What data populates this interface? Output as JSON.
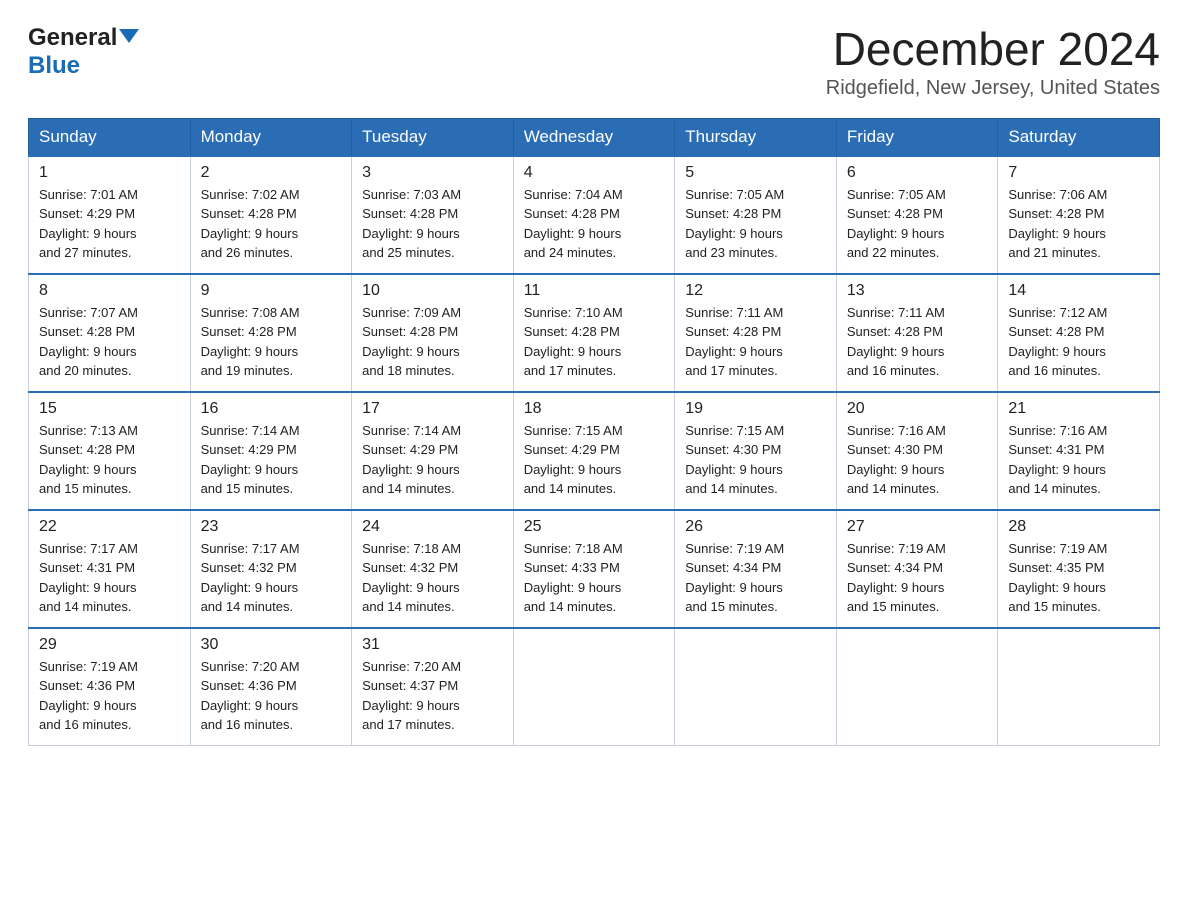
{
  "logo": {
    "general": "General",
    "blue": "Blue"
  },
  "title": "December 2024",
  "subtitle": "Ridgefield, New Jersey, United States",
  "days_of_week": [
    "Sunday",
    "Monday",
    "Tuesday",
    "Wednesday",
    "Thursday",
    "Friday",
    "Saturday"
  ],
  "weeks": [
    [
      {
        "day": "1",
        "sunrise": "7:01 AM",
        "sunset": "4:29 PM",
        "daylight": "9 hours and 27 minutes."
      },
      {
        "day": "2",
        "sunrise": "7:02 AM",
        "sunset": "4:28 PM",
        "daylight": "9 hours and 26 minutes."
      },
      {
        "day": "3",
        "sunrise": "7:03 AM",
        "sunset": "4:28 PM",
        "daylight": "9 hours and 25 minutes."
      },
      {
        "day": "4",
        "sunrise": "7:04 AM",
        "sunset": "4:28 PM",
        "daylight": "9 hours and 24 minutes."
      },
      {
        "day": "5",
        "sunrise": "7:05 AM",
        "sunset": "4:28 PM",
        "daylight": "9 hours and 23 minutes."
      },
      {
        "day": "6",
        "sunrise": "7:05 AM",
        "sunset": "4:28 PM",
        "daylight": "9 hours and 22 minutes."
      },
      {
        "day": "7",
        "sunrise": "7:06 AM",
        "sunset": "4:28 PM",
        "daylight": "9 hours and 21 minutes."
      }
    ],
    [
      {
        "day": "8",
        "sunrise": "7:07 AM",
        "sunset": "4:28 PM",
        "daylight": "9 hours and 20 minutes."
      },
      {
        "day": "9",
        "sunrise": "7:08 AM",
        "sunset": "4:28 PM",
        "daylight": "9 hours and 19 minutes."
      },
      {
        "day": "10",
        "sunrise": "7:09 AM",
        "sunset": "4:28 PM",
        "daylight": "9 hours and 18 minutes."
      },
      {
        "day": "11",
        "sunrise": "7:10 AM",
        "sunset": "4:28 PM",
        "daylight": "9 hours and 17 minutes."
      },
      {
        "day": "12",
        "sunrise": "7:11 AM",
        "sunset": "4:28 PM",
        "daylight": "9 hours and 17 minutes."
      },
      {
        "day": "13",
        "sunrise": "7:11 AM",
        "sunset": "4:28 PM",
        "daylight": "9 hours and 16 minutes."
      },
      {
        "day": "14",
        "sunrise": "7:12 AM",
        "sunset": "4:28 PM",
        "daylight": "9 hours and 16 minutes."
      }
    ],
    [
      {
        "day": "15",
        "sunrise": "7:13 AM",
        "sunset": "4:28 PM",
        "daylight": "9 hours and 15 minutes."
      },
      {
        "day": "16",
        "sunrise": "7:14 AM",
        "sunset": "4:29 PM",
        "daylight": "9 hours and 15 minutes."
      },
      {
        "day": "17",
        "sunrise": "7:14 AM",
        "sunset": "4:29 PM",
        "daylight": "9 hours and 14 minutes."
      },
      {
        "day": "18",
        "sunrise": "7:15 AM",
        "sunset": "4:29 PM",
        "daylight": "9 hours and 14 minutes."
      },
      {
        "day": "19",
        "sunrise": "7:15 AM",
        "sunset": "4:30 PM",
        "daylight": "9 hours and 14 minutes."
      },
      {
        "day": "20",
        "sunrise": "7:16 AM",
        "sunset": "4:30 PM",
        "daylight": "9 hours and 14 minutes."
      },
      {
        "day": "21",
        "sunrise": "7:16 AM",
        "sunset": "4:31 PM",
        "daylight": "9 hours and 14 minutes."
      }
    ],
    [
      {
        "day": "22",
        "sunrise": "7:17 AM",
        "sunset": "4:31 PM",
        "daylight": "9 hours and 14 minutes."
      },
      {
        "day": "23",
        "sunrise": "7:17 AM",
        "sunset": "4:32 PM",
        "daylight": "9 hours and 14 minutes."
      },
      {
        "day": "24",
        "sunrise": "7:18 AM",
        "sunset": "4:32 PM",
        "daylight": "9 hours and 14 minutes."
      },
      {
        "day": "25",
        "sunrise": "7:18 AM",
        "sunset": "4:33 PM",
        "daylight": "9 hours and 14 minutes."
      },
      {
        "day": "26",
        "sunrise": "7:19 AM",
        "sunset": "4:34 PM",
        "daylight": "9 hours and 15 minutes."
      },
      {
        "day": "27",
        "sunrise": "7:19 AM",
        "sunset": "4:34 PM",
        "daylight": "9 hours and 15 minutes."
      },
      {
        "day": "28",
        "sunrise": "7:19 AM",
        "sunset": "4:35 PM",
        "daylight": "9 hours and 15 minutes."
      }
    ],
    [
      {
        "day": "29",
        "sunrise": "7:19 AM",
        "sunset": "4:36 PM",
        "daylight": "9 hours and 16 minutes."
      },
      {
        "day": "30",
        "sunrise": "7:20 AM",
        "sunset": "4:36 PM",
        "daylight": "9 hours and 16 minutes."
      },
      {
        "day": "31",
        "sunrise": "7:20 AM",
        "sunset": "4:37 PM",
        "daylight": "9 hours and 17 minutes."
      },
      null,
      null,
      null,
      null
    ]
  ],
  "labels": {
    "sunrise": "Sunrise:",
    "sunset": "Sunset:",
    "daylight": "Daylight:"
  }
}
